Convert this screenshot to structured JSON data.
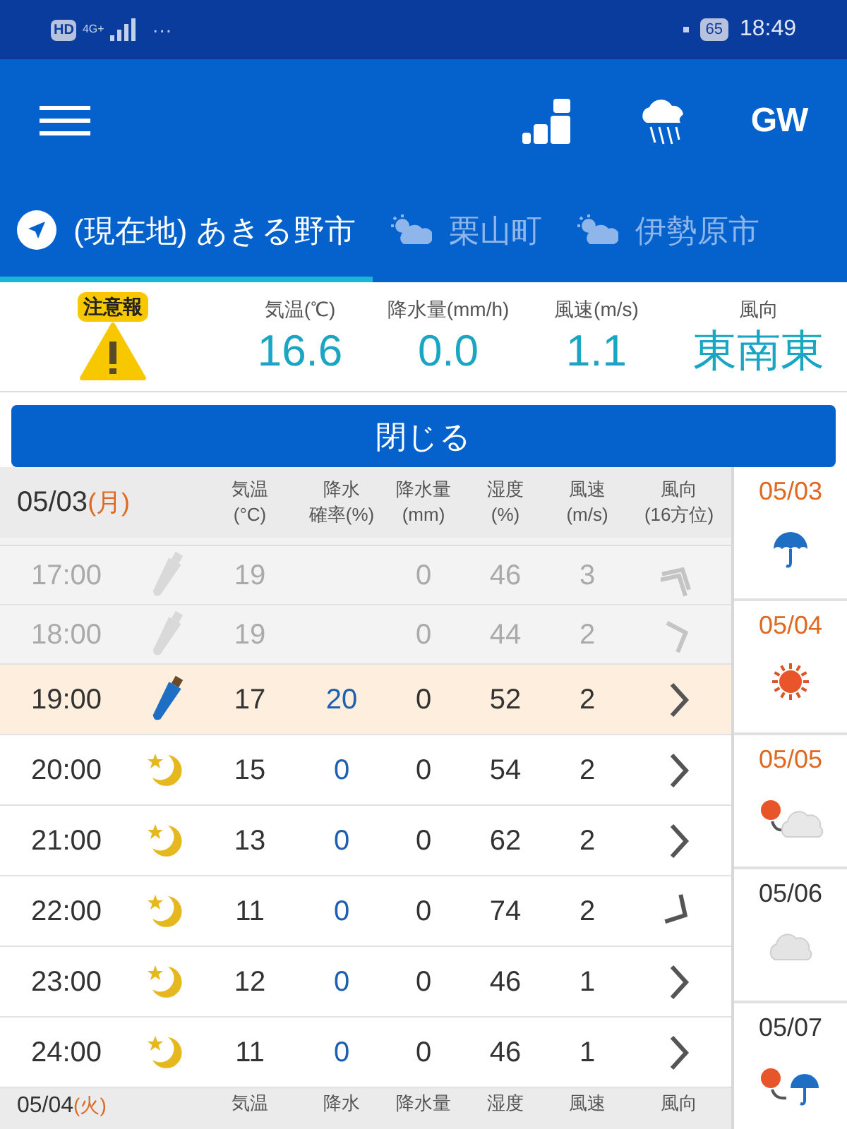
{
  "status_bar": {
    "left": [
      "HD",
      "4G+"
    ],
    "more": "···",
    "battery": "65",
    "time": "18:49"
  },
  "app_bar": {
    "gw_label": "GW"
  },
  "tabs": [
    {
      "label": "(現在地) あきる野市",
      "kind": "location",
      "selected": true
    },
    {
      "label": "栗山町",
      "kind": "weather",
      "selected": false
    },
    {
      "label": "伊勢原市",
      "kind": "weather",
      "selected": false
    }
  ],
  "current": {
    "alert": "注意報",
    "readings": [
      {
        "label": "気温(℃)",
        "value": "16.6"
      },
      {
        "label": "降水量(mm/h)",
        "value": "0.0"
      },
      {
        "label": "風速(m/s)",
        "value": "1.1"
      },
      {
        "label": "風向",
        "value": "東南東"
      }
    ]
  },
  "close_button": "閉じる",
  "day_header": {
    "date": "05/03",
    "weekday": "(月)",
    "holiday": true,
    "columns": [
      [
        "気温",
        "(°C)"
      ],
      [
        "降水",
        "確率(%)"
      ],
      [
        "降水量",
        "(mm)"
      ],
      [
        "湿度",
        "(%)"
      ],
      [
        "風速",
        "(m/s)"
      ],
      [
        "風向",
        "(16方位)"
      ]
    ]
  },
  "rows": [
    {
      "time": "17:00",
      "weather": {
        "kind": "umbrella"
      },
      "temp": "19",
      "prob": "",
      "amount": "0",
      "humidity": "46",
      "wind": "3",
      "wind_arrow": {
        "kind": "double-up"
      },
      "past": true,
      "current": false
    },
    {
      "time": "18:00",
      "weather": {
        "kind": "umbrella"
      },
      "temp": "19",
      "prob": "",
      "amount": "0",
      "humidity": "44",
      "wind": "2",
      "wind_arrow": {
        "kind": "up-right"
      },
      "past": true,
      "current": false
    },
    {
      "time": "19:00",
      "weather": {
        "kind": "umbrella"
      },
      "temp": "17",
      "prob": "20",
      "amount": "0",
      "humidity": "52",
      "wind": "2",
      "wind_arrow": {
        "kind": "right"
      },
      "past": false,
      "current": true
    },
    {
      "time": "20:00",
      "weather": {
        "kind": "moon"
      },
      "temp": "15",
      "prob": "0",
      "amount": "0",
      "humidity": "54",
      "wind": "2",
      "wind_arrow": {
        "kind": "right"
      },
      "past": false,
      "current": false
    },
    {
      "time": "21:00",
      "weather": {
        "kind": "moon"
      },
      "temp": "13",
      "prob": "0",
      "amount": "0",
      "humidity": "62",
      "wind": "2",
      "wind_arrow": {
        "kind": "right"
      },
      "past": false,
      "current": false
    },
    {
      "time": "22:00",
      "weather": {
        "kind": "moon"
      },
      "temp": "11",
      "prob": "0",
      "amount": "0",
      "humidity": "74",
      "wind": "2",
      "wind_arrow": {
        "kind": "down-right"
      },
      "past": false,
      "current": false
    },
    {
      "time": "23:00",
      "weather": {
        "kind": "moon"
      },
      "temp": "12",
      "prob": "0",
      "amount": "0",
      "humidity": "46",
      "wind": "1",
      "wind_arrow": {
        "kind": "right"
      },
      "past": false,
      "current": false
    },
    {
      "time": "24:00",
      "weather": {
        "kind": "moon"
      },
      "temp": "11",
      "prob": "0",
      "amount": "0",
      "humidity": "46",
      "wind": "1",
      "wind_arrow": {
        "kind": "right"
      },
      "past": false,
      "current": false
    }
  ],
  "next_header": {
    "date": "05/04",
    "weekday": "(火)",
    "holiday": true,
    "columns": [
      "気温",
      "降水",
      "降水量",
      "湿度",
      "風速",
      "風向"
    ]
  },
  "days": [
    {
      "date": "05/03",
      "holiday": true,
      "kind": "umbrella"
    },
    {
      "date": "05/04",
      "holiday": true,
      "kind": "sun"
    },
    {
      "date": "05/05",
      "holiday": true,
      "kind": "sun-cloud"
    },
    {
      "date": "05/06",
      "holiday": false,
      "kind": "cloud"
    },
    {
      "date": "05/07",
      "holiday": false,
      "kind": "sun-umbrella"
    }
  ]
}
